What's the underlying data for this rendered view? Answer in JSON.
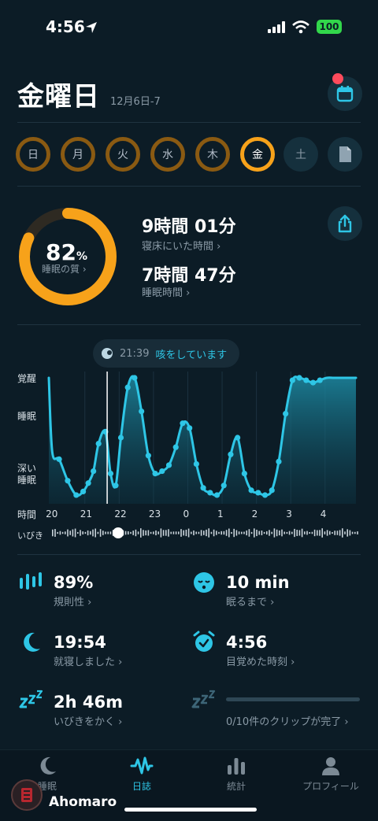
{
  "status_bar": {
    "time": "4:56",
    "battery": "100"
  },
  "header": {
    "title": "金曜日",
    "date": "12月6日-7"
  },
  "week": {
    "days": [
      {
        "label": "日",
        "state": "partial"
      },
      {
        "label": "月",
        "state": "partial"
      },
      {
        "label": "火",
        "state": "partial"
      },
      {
        "label": "水",
        "state": "partial"
      },
      {
        "label": "木",
        "state": "partial"
      },
      {
        "label": "金",
        "state": "active"
      },
      {
        "label": "土",
        "state": "empty"
      }
    ]
  },
  "summary": {
    "score": "82",
    "score_unit": "%",
    "score_fraction": 0.82,
    "score_label": "睡眠の質 ›",
    "time_in_bed": "9時間 01分",
    "time_in_bed_label": "寝床にいた時間 ›",
    "sleep_time": "7時間 47分",
    "sleep_time_label": "睡眠時間 ›"
  },
  "event": {
    "time": "21:39",
    "text": "咳をしています"
  },
  "chart_data": {
    "type": "area",
    "y_levels": [
      "覚醒",
      "睡眠",
      "深い\n睡眠"
    ],
    "y_axis_title": "時間",
    "x_ticks": [
      "20",
      "21",
      "22",
      "23",
      "0",
      "1",
      "2",
      "3",
      "4"
    ],
    "snore_label": "いびき",
    "series": [
      {
        "x": [
          19.95,
          20.05,
          20.25,
          20.5,
          20.75,
          20.95,
          21.1,
          21.25,
          21.4,
          21.6,
          21.75,
          21.9,
          22.05,
          22.25,
          22.45,
          22.65,
          22.85,
          23.05,
          23.25,
          23.45,
          23.65,
          23.85,
          24.05,
          24.25,
          24.45,
          24.65,
          24.85,
          25.05,
          25.25,
          25.45,
          25.65,
          25.85,
          26.05,
          26.25,
          26.45,
          26.65,
          26.85,
          27.05,
          27.25,
          27.45,
          27.65,
          27.85,
          28.05,
          28.25,
          28.45,
          28.65,
          28.9
        ],
        "y": [
          1.0,
          0.38,
          0.32,
          0.14,
          0.02,
          0.05,
          0.12,
          0.22,
          0.45,
          0.55,
          0.2,
          0.1,
          0.5,
          0.92,
          1.0,
          0.72,
          0.35,
          0.2,
          0.22,
          0.27,
          0.42,
          0.62,
          0.58,
          0.28,
          0.08,
          0.04,
          0.02,
          0.1,
          0.36,
          0.5,
          0.2,
          0.06,
          0.04,
          0.02,
          0.06,
          0.3,
          0.7,
          0.98,
          1.0,
          0.98,
          0.96,
          0.98,
          1.0,
          1.0,
          1.0,
          1.0,
          1.0
        ]
      }
    ]
  },
  "stats": [
    {
      "icon": "regularity-icon",
      "value": "89%",
      "label": "規則性 ›"
    },
    {
      "icon": "sleep-face-icon",
      "value": "10 min",
      "label": "眠るまで ›"
    },
    {
      "icon": "moon-icon",
      "value": "19:54",
      "label": "就寝しました ›"
    },
    {
      "icon": "alarm-icon",
      "value": "4:56",
      "label": "目覚めた時刻 ›"
    },
    {
      "icon": "snore-icon",
      "value": "2h 46m",
      "label": "いびきをかく ›"
    },
    {
      "icon": "snore-clip-icon",
      "value": "",
      "label": "0/10件のクリップが完了 ›"
    }
  ],
  "tabs": [
    {
      "label": "睡眠",
      "icon": "moon-icon",
      "active": false
    },
    {
      "label": "日誌",
      "icon": "wave-icon",
      "active": true
    },
    {
      "label": "統計",
      "icon": "bars-icon",
      "active": false
    },
    {
      "label": "プロフィール",
      "icon": "person-icon",
      "active": false
    }
  ],
  "watermark": "Ahomaro",
  "colors": {
    "accent": "#2ec6e6",
    "score": "#f7a21a",
    "ring_dim": "#8a5a12",
    "background": "#0c1c26"
  }
}
